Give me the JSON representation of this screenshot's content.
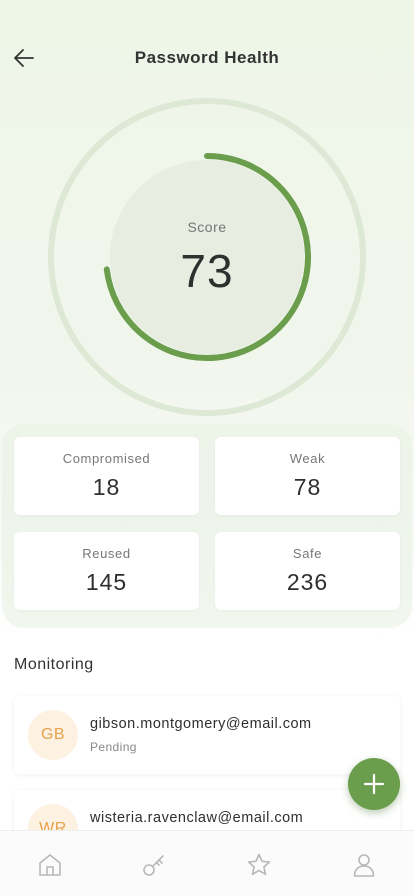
{
  "header": {
    "title": "Password Health",
    "back_icon": "arrow-left-icon"
  },
  "score": {
    "label": "Score",
    "value": "73",
    "progress_fraction": 0.73
  },
  "stats": [
    {
      "label": "Compromised",
      "value": "18"
    },
    {
      "label": "Weak",
      "value": "78"
    },
    {
      "label": "Reused",
      "value": "145"
    },
    {
      "label": "Safe",
      "value": "236"
    }
  ],
  "monitoring": {
    "title": "Monitoring",
    "items": [
      {
        "initials": "GB",
        "email": "gibson.montgomery@email.com",
        "status": "Pending"
      },
      {
        "initials": "WR",
        "email": "wisteria.ravenclaw@email.com",
        "status": ""
      }
    ]
  },
  "fab": {
    "icon": "plus-icon"
  },
  "bottom_nav": [
    {
      "icon": "home-icon"
    },
    {
      "icon": "key-icon"
    },
    {
      "icon": "star-icon"
    },
    {
      "icon": "user-icon"
    }
  ],
  "colors": {
    "accent": "#6a9e4c",
    "ring_track": "#dde8d5",
    "avatar_bg": "#fdf1e2",
    "avatar_text": "#e8a24e"
  }
}
